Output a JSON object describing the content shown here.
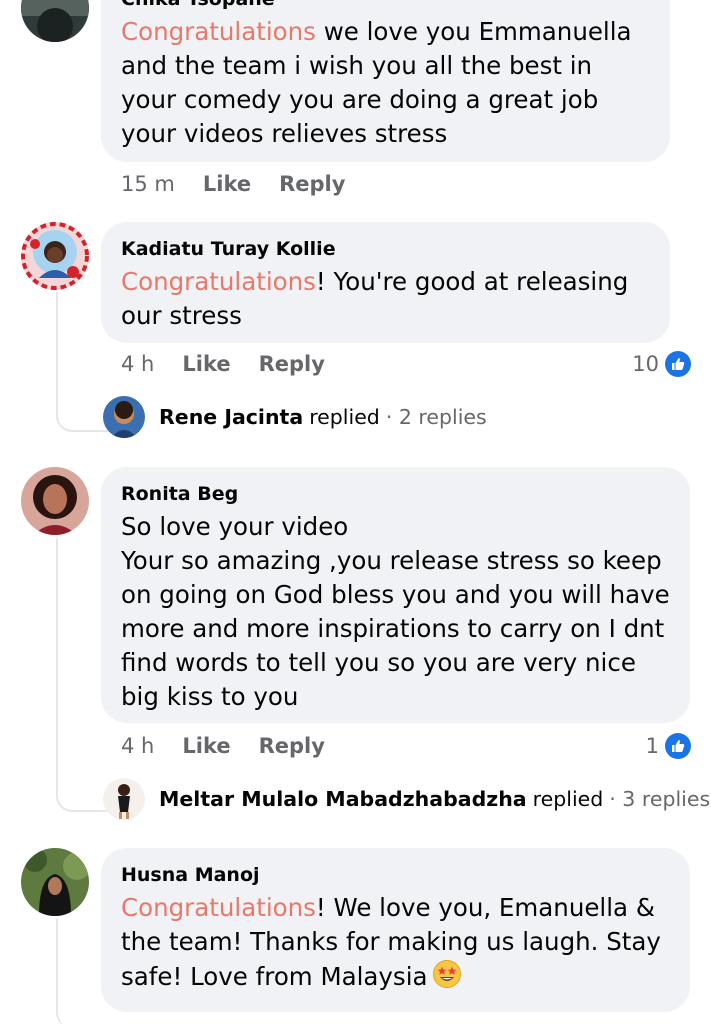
{
  "comments": [
    {
      "author": "Chika Tsopane",
      "highlight": "Congratulations",
      "text": " we love you Emmanuella and the team i wish you all the best in your comedy you are doing a great job your videos relieves stress",
      "time": "15 m",
      "like_label": "Like",
      "reply_label": "Reply"
    },
    {
      "author": "Kadiatu Turay Kollie",
      "highlight": "Congratulations",
      "text": "! You're good at releasing our stress",
      "time": "4 h",
      "like_label": "Like",
      "reply_label": "Reply",
      "reaction_count": "10",
      "reply_summary": {
        "name": "Rene Jacinta",
        "word": "replied",
        "count": "· 2 replies"
      }
    },
    {
      "author": "Ronita Beg",
      "text": "So love your video\nYour so amazing ,you release stress so keep on going on God bless you and you will have more and more inspirations to carry on I dnt find words to tell you so you are very nice big kiss to you",
      "time": "4 h",
      "like_label": "Like",
      "reply_label": "Reply",
      "reaction_count": "1",
      "reply_summary": {
        "name": "Meltar Mulalo Mabadzhabadzha",
        "word": "replied",
        "count": "· 3 replies"
      }
    },
    {
      "author": "Husna Manoj",
      "highlight": "Congratulations",
      "text": "! We love you, Emanuella & the team! Thanks for making us laugh. Stay safe! Love from Malaysia",
      "emoji": "star-struck-emoji"
    }
  ],
  "colors": {
    "highlight": "#e8796a",
    "like_blue": "#1b74e4",
    "bubble": "#f0f2f5",
    "muted": "#65676b"
  },
  "icons": {
    "reaction": "thumbs-up-icon"
  }
}
